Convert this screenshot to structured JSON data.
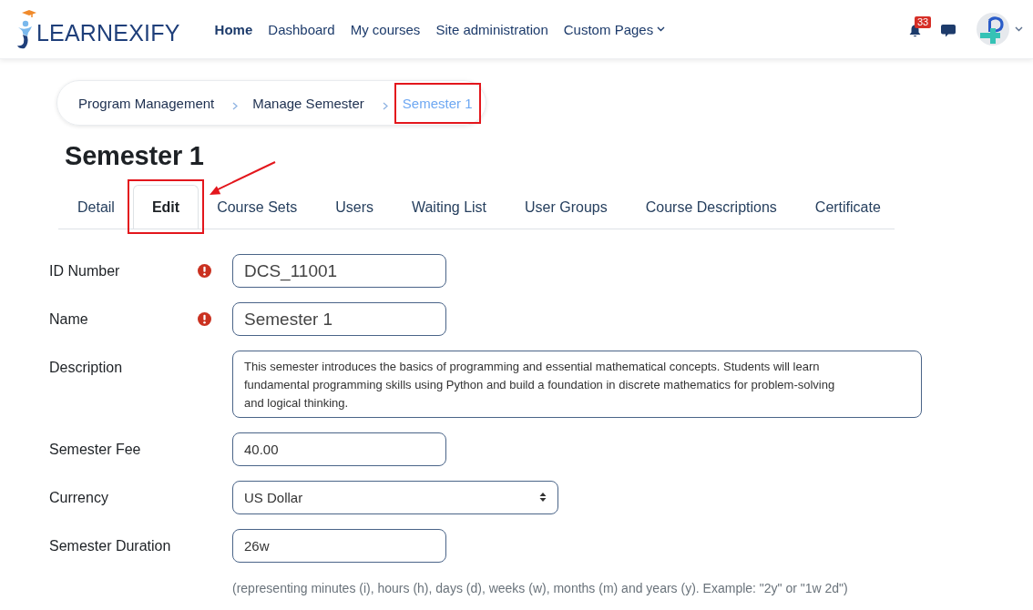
{
  "header": {
    "logo": "LEARNEXIFY",
    "nav": [
      {
        "label": "Home",
        "selected": true,
        "dropdown": false
      },
      {
        "label": "Dashboard",
        "selected": false,
        "dropdown": false
      },
      {
        "label": "My courses",
        "selected": false,
        "dropdown": false
      },
      {
        "label": "Site administration",
        "selected": false,
        "dropdown": false
      },
      {
        "label": "Custom Pages",
        "selected": false,
        "dropdown": true
      }
    ],
    "notification_count": "33"
  },
  "breadcrumb": [
    {
      "label": "Program Management",
      "current": false,
      "highlighted": false
    },
    {
      "label": "Manage Semester",
      "current": false,
      "highlighted": false
    },
    {
      "label": "Semester 1",
      "current": true,
      "highlighted": true
    }
  ],
  "page_title": "Semester 1",
  "tabs": [
    {
      "label": "Detail",
      "selected": false,
      "highlighted": false
    },
    {
      "label": "Edit",
      "selected": true,
      "highlighted": true
    },
    {
      "label": "Course Sets",
      "selected": false,
      "highlighted": false
    },
    {
      "label": "Users",
      "selected": false,
      "highlighted": false
    },
    {
      "label": "Waiting List",
      "selected": false,
      "highlighted": false
    },
    {
      "label": "User Groups",
      "selected": false,
      "highlighted": false
    },
    {
      "label": "Course Descriptions",
      "selected": false,
      "highlighted": false
    },
    {
      "label": "Certificate",
      "selected": false,
      "highlighted": false
    }
  ],
  "form": {
    "fields": [
      {
        "kind": "text",
        "label": "ID Number",
        "required": true,
        "value": "DCS_11001"
      },
      {
        "kind": "text",
        "label": "Name",
        "required": true,
        "value": "Semester 1"
      },
      {
        "kind": "textarea",
        "label": "Description",
        "required": false,
        "value": "This semester introduces the basics of programming and essential mathematical concepts. Students will learn fundamental programming skills using Python and build a foundation in discrete mathematics for problem-solving and logical thinking."
      },
      {
        "kind": "text",
        "label": "Semester Fee",
        "required": false,
        "value": "40.00"
      },
      {
        "kind": "select",
        "label": "Currency",
        "required": false,
        "value": "US Dollar"
      },
      {
        "kind": "text",
        "label": "Semester Duration",
        "required": false,
        "value": "26w",
        "help": "(representing minutes (i), hours (h), days (d), weeks (w), months (m) and years (y). Example: \"2y\" or \"1w 2d\")"
      }
    ]
  }
}
